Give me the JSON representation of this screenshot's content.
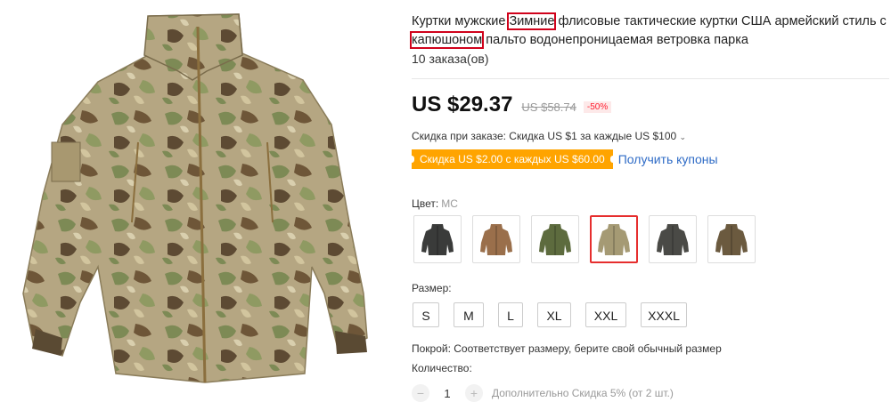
{
  "product": {
    "title_part1": "Куртки мужские ",
    "title_highlight1": "Зимние",
    "title_part2": " флисовые тактические куртки США армейский стиль с ",
    "title_highlight2": "капюшоном",
    "title_part3": " пальто водонепроницаемая ветровка парка",
    "orders": "10 заказа(ов)",
    "image_alt": "Camouflage tactical jacket photo"
  },
  "price": {
    "current": "US $29.37",
    "original": "US $58.74",
    "discount_badge": "-50%"
  },
  "order_discount": "Скидка при заказе: Скидка US $1 за каждые US $100",
  "coupon": {
    "tag": "Скидка US $2.00 с каждых US $60.00",
    "link": "Получить купоны"
  },
  "color": {
    "label": "Цвет:",
    "value": "MC",
    "swatches": [
      {
        "name": "black",
        "color": "#3a3b3a"
      },
      {
        "name": "tan",
        "color": "#9a6f4b"
      },
      {
        "name": "green",
        "color": "#5d6b3e"
      },
      {
        "name": "multicam",
        "color": "#a59a74",
        "selected": true
      },
      {
        "name": "grey",
        "color": "#4a4a46"
      },
      {
        "name": "woodland",
        "color": "#6b5a3f"
      }
    ]
  },
  "size": {
    "label": "Размер:",
    "options": [
      "S",
      "M",
      "L",
      "XL",
      "XXL",
      "XXXL"
    ]
  },
  "fit": "Покрой: Соответствует размеру, берите свой обычный размер",
  "quantity": {
    "label": "Количество:",
    "value": "1",
    "extra_discount": "Дополнительно Скидка 5% (от 2 шт.)"
  },
  "colors": {
    "accent_red": "#e62e2e",
    "coupon_orange": "#ffa400",
    "link_blue": "#2e6bc6"
  }
}
